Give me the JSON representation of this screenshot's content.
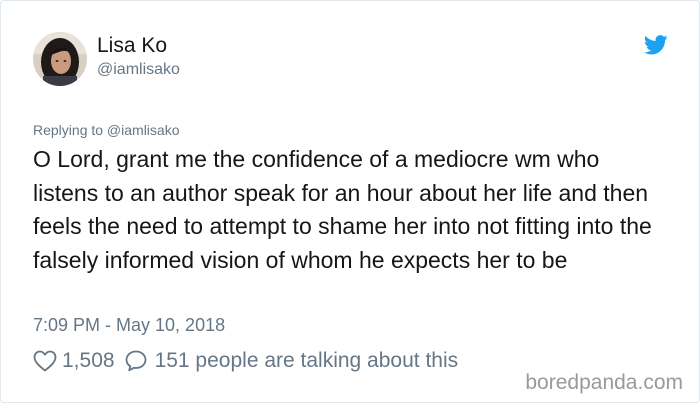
{
  "tweet": {
    "display_name": "Lisa Ko",
    "handle": "@iamlisako",
    "replying_to": "Replying to @iamlisako",
    "text": "O Lord, grant me the confidence of a mediocre wm who listens to an author speak for an hour about her life and then feels the need to attempt to shame her into not fitting into the falsely informed vision of whom he expects her to be",
    "timestamp": "7:09 PM - May 10, 2018",
    "likes": "1,508",
    "talking": "151 people are talking about this"
  },
  "icons": {
    "brand": "twitter-bird-icon",
    "like": "heart-icon",
    "reply": "speech-bubble-icon"
  },
  "watermark": "boredpanda.com",
  "colors": {
    "twitter_blue": "#1da1f2",
    "text_primary": "#14171a",
    "text_secondary": "#657786",
    "border": "#e1e8ed",
    "watermark": "#999999"
  }
}
